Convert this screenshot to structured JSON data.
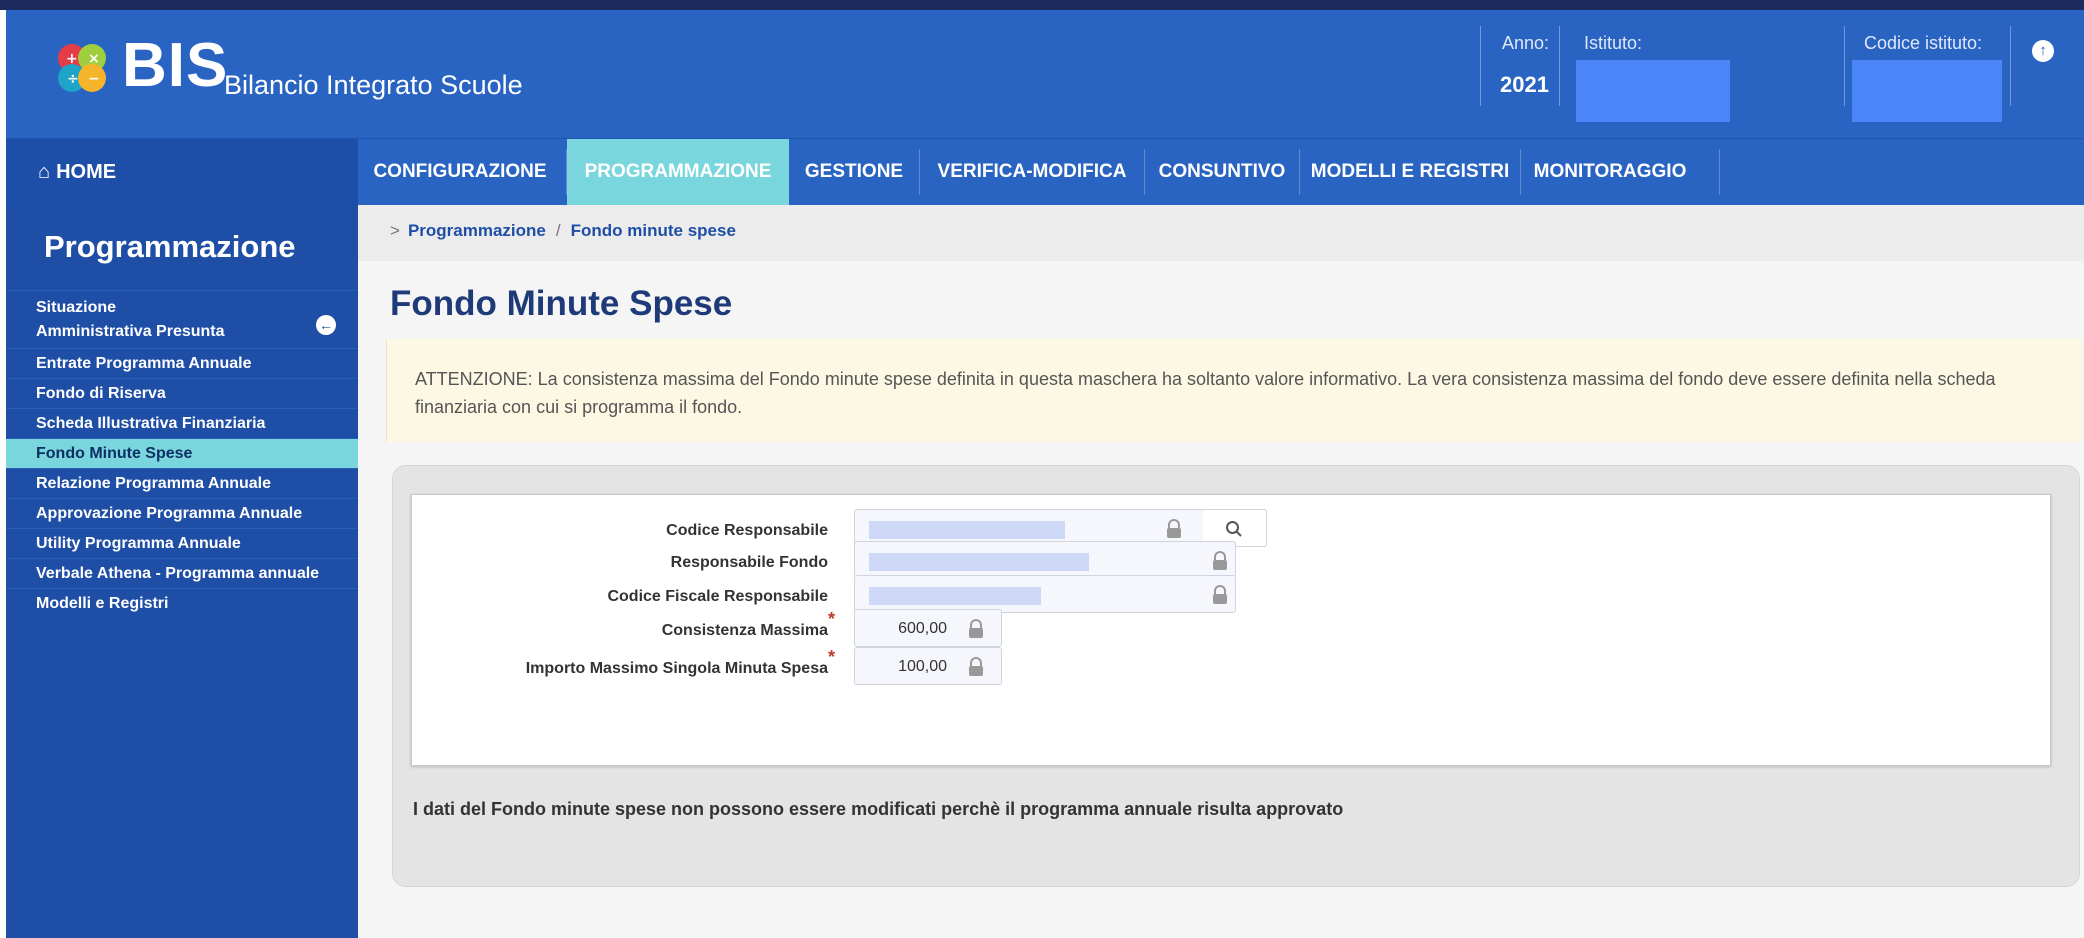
{
  "header": {
    "brand": "BIS",
    "subtitle": "Bilancio Integrato Scuole",
    "anno_label": "Anno:",
    "anno_value": "2021",
    "istituto_label": "Istituto:",
    "codice_label": "Codice istituto:"
  },
  "nav": {
    "home": "HOME",
    "tabs": [
      "CONFIGURAZIONE",
      "PROGRAMMAZIONE",
      "GESTIONE",
      "VERIFICA-MODIFICA",
      "CONSUNTIVO",
      "MODELLI E REGISTRI",
      "MONITORAGGIO"
    ],
    "active_tab": "PROGRAMMAZIONE"
  },
  "sidebar": {
    "title": "Programmazione",
    "items": [
      "Situazione Amministrativa Presunta",
      "Entrate Programma Annuale",
      "Fondo di Riserva",
      "Scheda Illustrativa Finanziaria",
      "Fondo Minute Spese",
      "Relazione Programma Annuale",
      "Approvazione Programma Annuale",
      "Utility Programma Annuale",
      "Verbale Athena - Programma annuale",
      "Modelli e Registri"
    ],
    "active_item": "Fondo Minute Spese"
  },
  "breadcrumb": {
    "prefix": ">",
    "items": [
      "Programmazione",
      "Fondo minute spese"
    ],
    "separator": "/"
  },
  "page": {
    "title": "Fondo Minute Spese",
    "alert": "ATTENZIONE: La consistenza massima del Fondo minute spese definita in questa maschera ha soltanto valore informativo. La vera consistenza massima del fondo deve essere definita nella scheda finanziaria con cui si programma il fondo."
  },
  "form": {
    "codice_responsabile": {
      "label": "Codice Responsabile"
    },
    "responsabile_fondo": {
      "label": "Responsabile Fondo"
    },
    "codice_fiscale": {
      "label": "Codice Fiscale Responsabile"
    },
    "consistenza_massima": {
      "label": "Consistenza Massima",
      "value": "600,00",
      "required_mark": "*"
    },
    "importo_massimo": {
      "label": "Importo Massimo Singola Minuta Spesa",
      "value": "100,00",
      "required_mark": "*"
    }
  },
  "message": "I dati del Fondo minute spese non possono essere modificati perchè il programma annuale risulta approvato",
  "colors": {
    "header_blue": "#2a64c2",
    "sidebar_blue": "#1f4ea6",
    "active_teal": "#7ad6dd",
    "title_navy": "#1f3a78",
    "alert_bg": "#fdf8e4",
    "required_red": "#c0392b"
  },
  "icons": [
    "bis-logo-icon",
    "help-icon",
    "home-icon",
    "collapse-sidebar-icon",
    "lock-icon",
    "search-icon"
  ]
}
